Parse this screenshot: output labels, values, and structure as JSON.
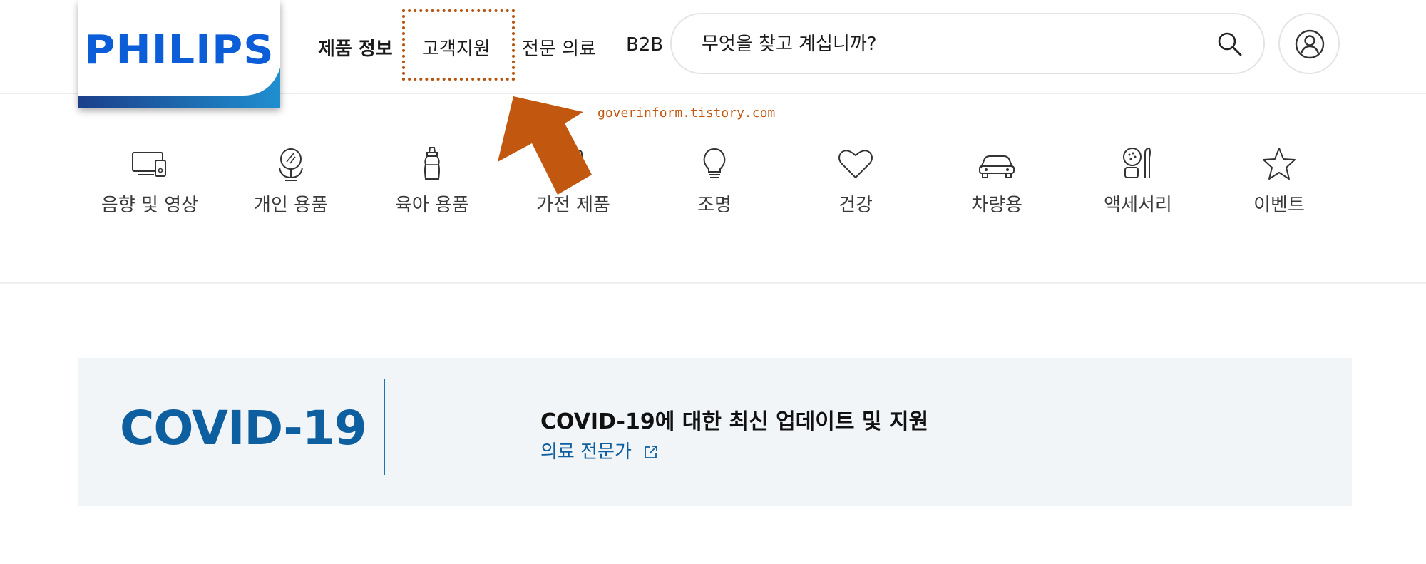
{
  "brand": {
    "logo_text": "PHILIPS",
    "primary_color": "#0b5ed7",
    "accent_color": "#1e73b8"
  },
  "nav": {
    "items": [
      {
        "label": "제품 정보",
        "active": true
      },
      {
        "label": "고객지원",
        "highlighted": true
      },
      {
        "label": "전문 의료"
      },
      {
        "label": "B2B"
      }
    ]
  },
  "search": {
    "placeholder": "무엇을 찾고 계십니까?",
    "icon": "search-icon"
  },
  "account": {
    "icon": "user-icon"
  },
  "annotation": {
    "watermark": "goverinform.tistory.com",
    "arrow_color": "#c2570f"
  },
  "categories": [
    {
      "label": "음향 및 영상",
      "icon": "tv-speaker-icon"
    },
    {
      "label": "개인 용품",
      "icon": "mirror-icon"
    },
    {
      "label": "육아 용품",
      "icon": "baby-bottle-icon"
    },
    {
      "label": "가전 제품",
      "icon": "appliance-icon"
    },
    {
      "label": "조명",
      "icon": "lightbulb-icon"
    },
    {
      "label": "건강",
      "icon": "heart-icon"
    },
    {
      "label": "차량용",
      "icon": "car-icon"
    },
    {
      "label": "액세서리",
      "icon": "accessory-icon"
    },
    {
      "label": "이벤트",
      "icon": "star-icon"
    }
  ],
  "covid": {
    "title": "COVID-19",
    "heading": "COVID-19에 대한 최신 업데이트 및 지원",
    "link_label": "의료 전문가",
    "link_icon": "external-link-icon"
  }
}
